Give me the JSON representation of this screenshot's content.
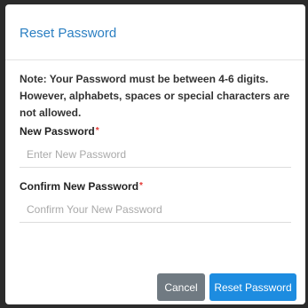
{
  "dialog": {
    "title": "Reset Password",
    "note": "Note: Your Password must be between 4-6 digits. However, alphabets, spaces or special characters are not allowed.",
    "fields": [
      {
        "label": "New Password",
        "required_mark": "*",
        "value": "",
        "placeholder": "Enter New Password"
      },
      {
        "label": "Confirm New Password",
        "required_mark": "*",
        "value": "",
        "placeholder": "Confirm Your New Password"
      }
    ],
    "buttons": {
      "cancel": "Cancel",
      "submit": "Reset Password"
    }
  },
  "colors": {
    "title": "#2b7fc2",
    "required": "#e53935",
    "cancel_button": "#707a82",
    "primary_button": "#1d8ce0"
  }
}
